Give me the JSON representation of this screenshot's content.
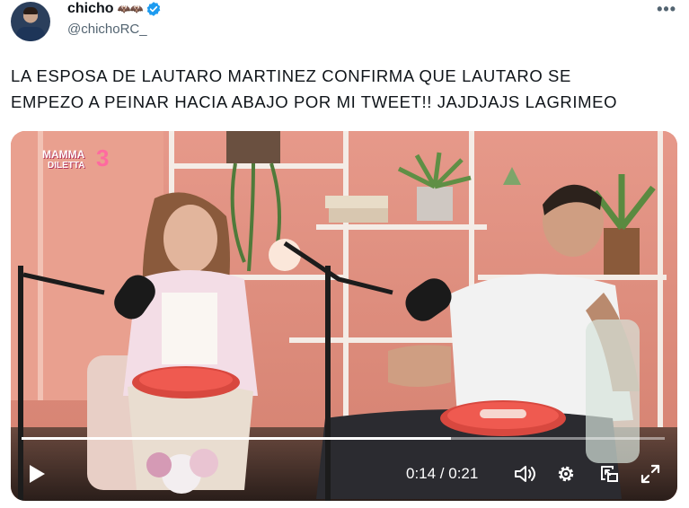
{
  "author": {
    "display_name": "chicho",
    "name_emoji": "🦇🦇",
    "handle": "@chichoRC_",
    "verified": true
  },
  "tweet": {
    "text_line1": "LA ESPOSA DE LAUTARO MARTINEZ CONFIRMA QUE LAUTARO SE",
    "text_line2": "EMPEZO A PEINAR HACIA ABAJO POR MI TWEET!! JAJDJAJS LAGRIMEO"
  },
  "video": {
    "show_logo": {
      "line1": "MAMMA",
      "line2": "DILETTA",
      "episode": "3"
    },
    "current_time": "0:14",
    "duration": "0:21",
    "time_text": "0:14 / 0:21",
    "progress": 0.667
  },
  "icons": {
    "more": "more-options-icon",
    "verified": "verified-badge-icon",
    "play": "play-icon",
    "volume": "volume-icon",
    "settings": "gear-icon",
    "pip": "picture-in-picture-icon",
    "fullscreen": "fullscreen-icon"
  },
  "colors": {
    "verified_blue": "#1d9bf0",
    "handle_gray": "#536471",
    "set_wall": "#e08f7d",
    "text_black": "#0f1419"
  }
}
